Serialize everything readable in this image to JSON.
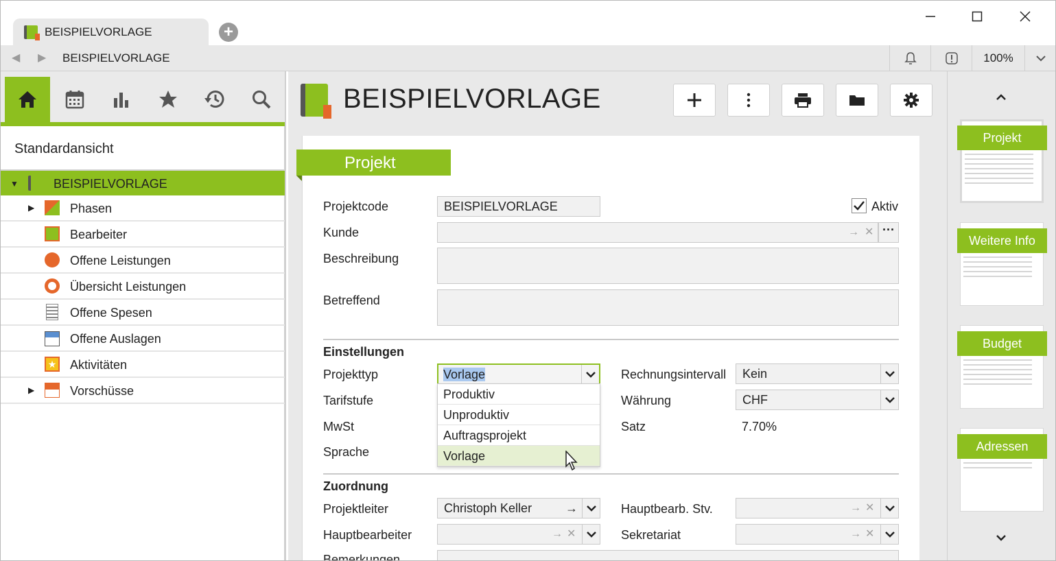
{
  "app": {
    "tab_title": "BEISPIELVORLAGE",
    "address": "BEISPIELVORLAGE",
    "zoom": "100%"
  },
  "sidebar": {
    "view_name": "Standardansicht",
    "root_label": "BEISPIELVORLAGE",
    "items": [
      {
        "label": "Phasen",
        "expandable": true
      },
      {
        "label": "Bearbeiter",
        "expandable": false
      },
      {
        "label": "Offene Leistungen",
        "expandable": false
      },
      {
        "label": "Übersicht Leistungen",
        "expandable": false
      },
      {
        "label": "Offene Spesen",
        "expandable": false
      },
      {
        "label": "Offene Auslagen",
        "expandable": false
      },
      {
        "label": "Aktivitäten",
        "expandable": false
      },
      {
        "label": "Vorschüsse",
        "expandable": true
      }
    ]
  },
  "main": {
    "title": "BEISPIELVORLAGE",
    "section_label": "Projekt",
    "fields": {
      "projektcode_label": "Projektcode",
      "projektcode_value": "BEISPIELVORLAGE",
      "aktiv_label": "Aktiv",
      "kunde_label": "Kunde",
      "beschreibung_label": "Beschreibung",
      "betreffend_label": "Betreffend"
    },
    "einstellungen": {
      "heading": "Einstellungen",
      "projekttyp_label": "Projekttyp",
      "projekttyp_value": "Vorlage",
      "tarifstufe_label": "Tarifstufe",
      "mwst_label": "MwSt",
      "sprache_label": "Sprache",
      "rechnungsintervall_label": "Rechnungsintervall",
      "rechnungsintervall_value": "Kein",
      "waehrung_label": "Währung",
      "waehrung_value": "CHF",
      "satz_label": "Satz",
      "satz_value": "7.70%",
      "projekttyp_options": [
        "Produktiv",
        "Unproduktiv",
        "Auftragsprojekt",
        "Vorlage"
      ]
    },
    "zuordnung": {
      "heading": "Zuordnung",
      "projektleiter_label": "Projektleiter",
      "projektleiter_value": "Christoph Keller",
      "hauptbearbeiter_label": "Hauptbearbeiter",
      "hauptbearb_stv_label": "Hauptbearb. Stv.",
      "sekretariat_label": "Sekretariat",
      "bemerkungen_label": "Bemerkungen"
    }
  },
  "right_panel": {
    "pages": [
      "Projekt",
      "Weitere Info",
      "Budget",
      "Adressen"
    ]
  },
  "colors": {
    "accent": "#8dbf1f",
    "accent_dark": "#5e8214",
    "panel_bg": "#e9e9e9"
  }
}
